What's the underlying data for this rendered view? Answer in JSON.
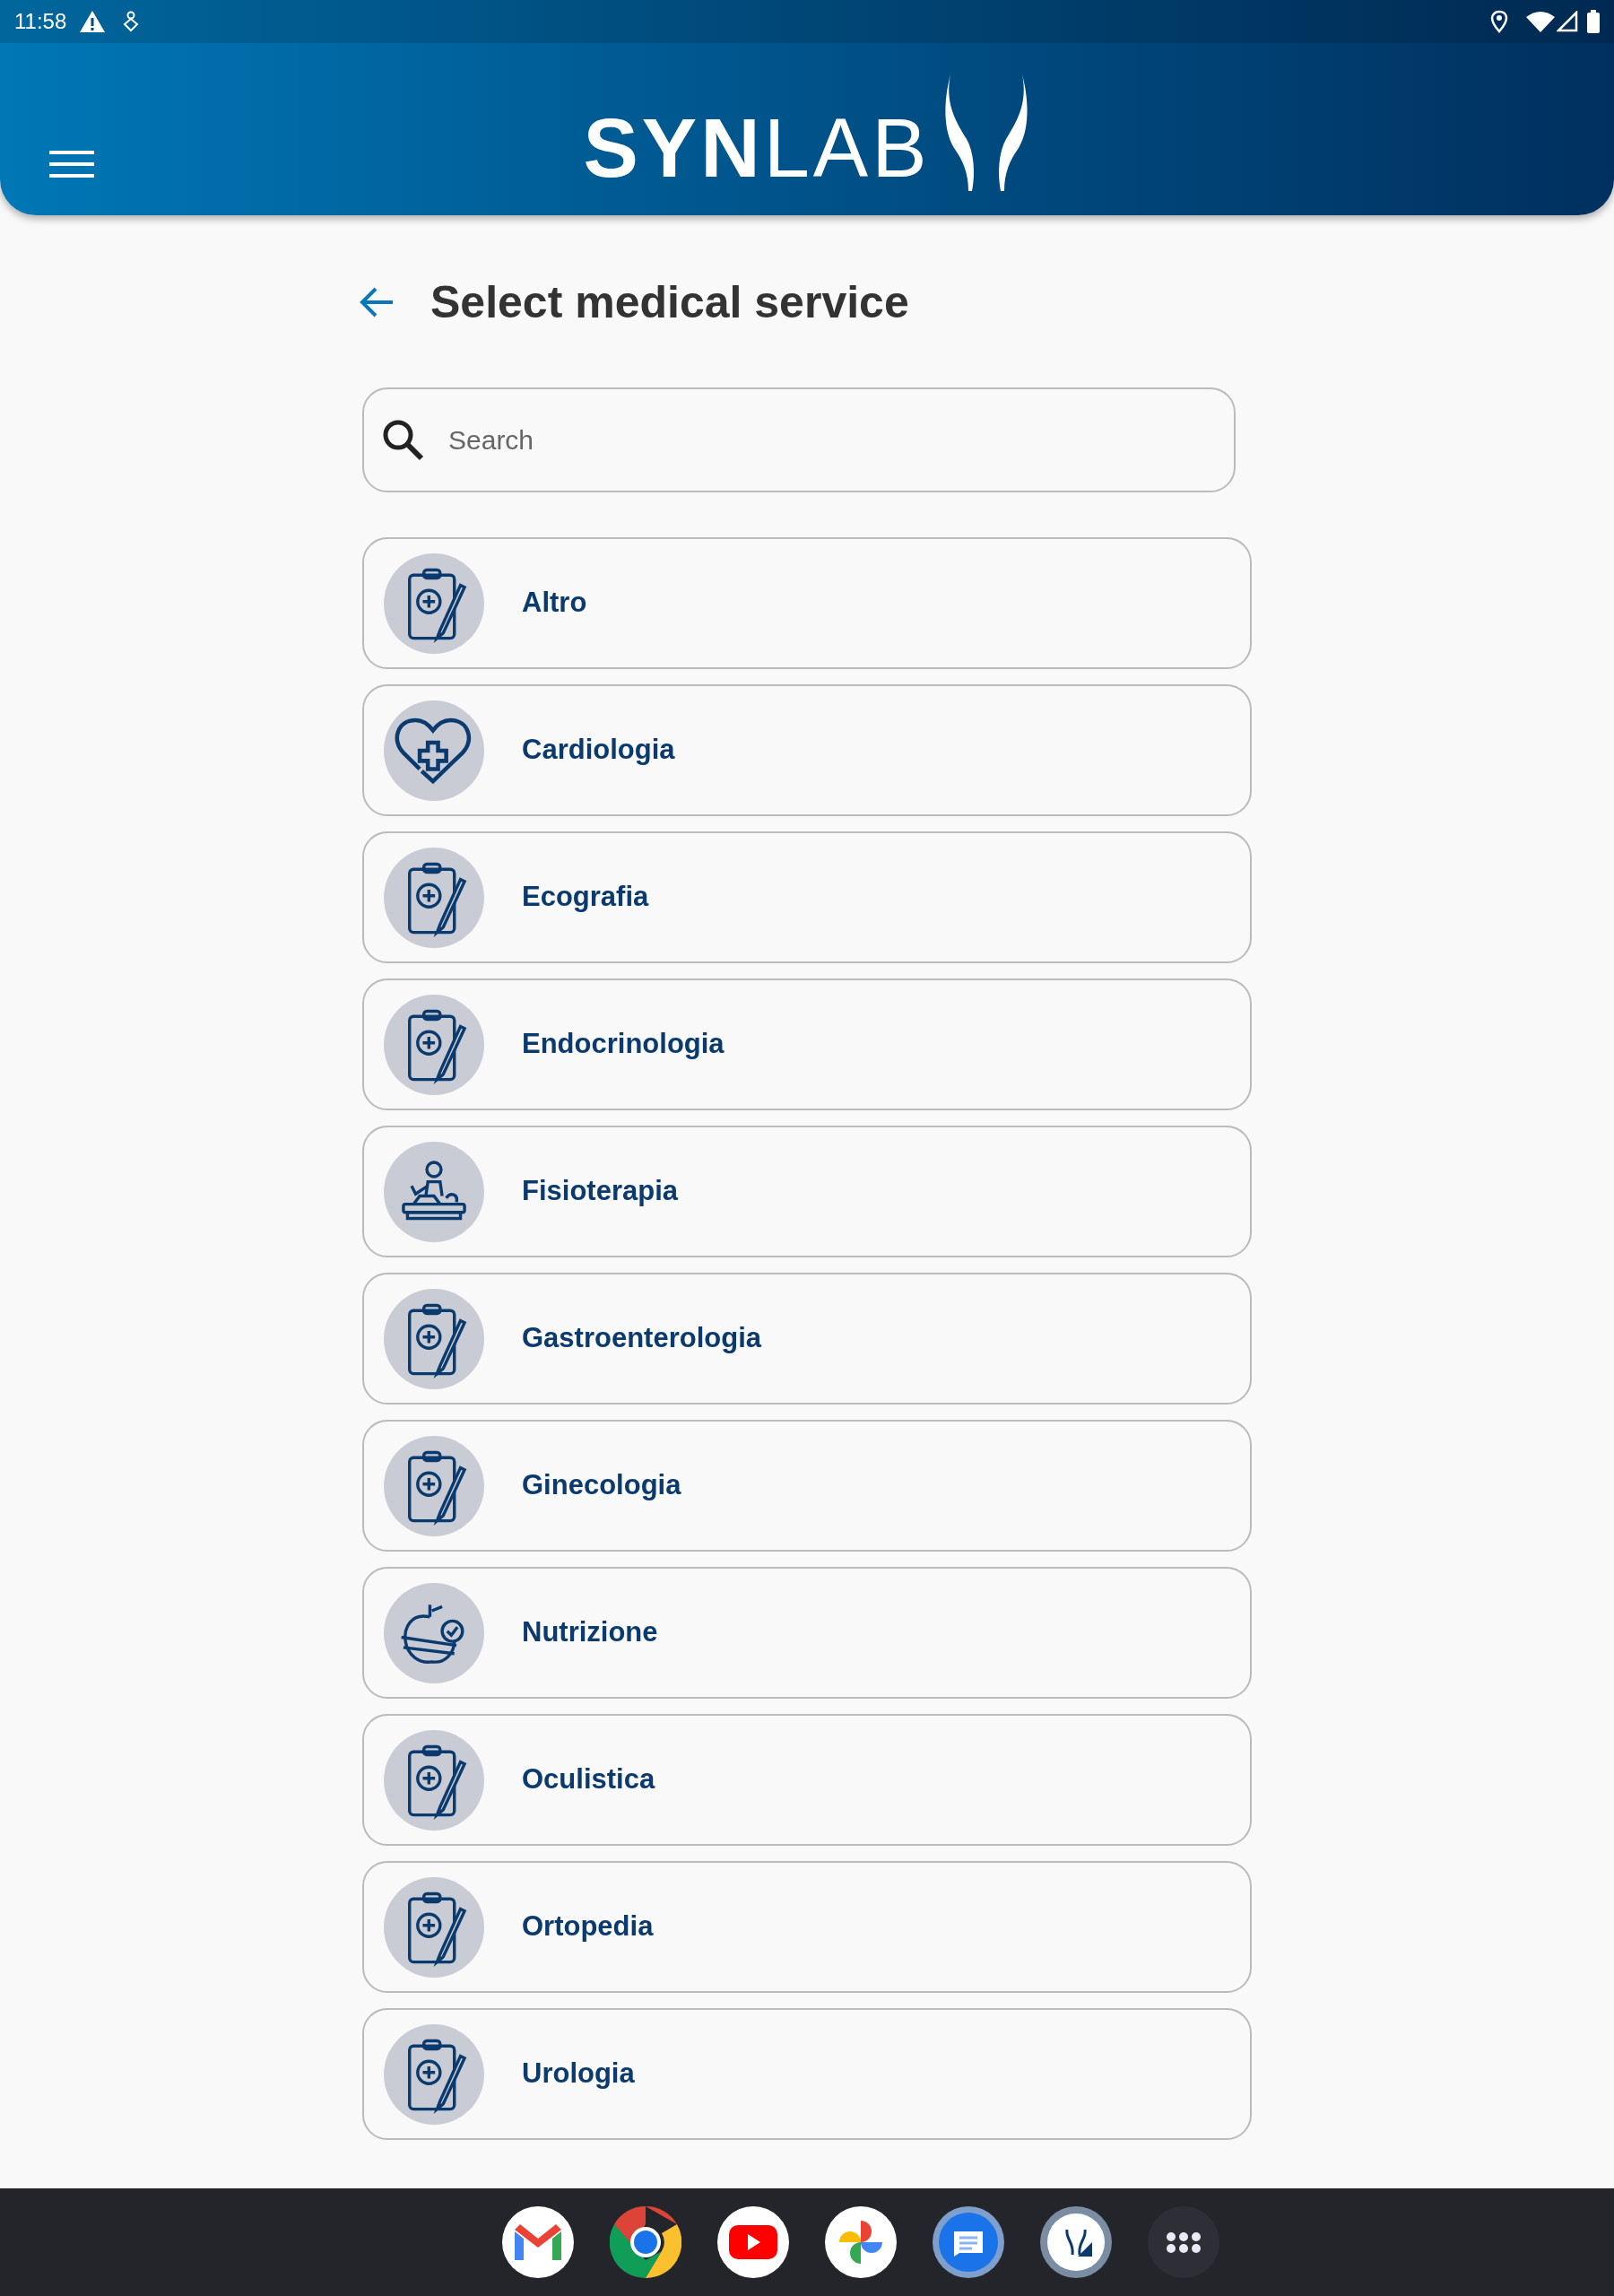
{
  "status_bar": {
    "time": "11:58"
  },
  "header": {
    "logo_bold": "SYN",
    "logo_light": "LAB"
  },
  "page": {
    "title": "Select medical service"
  },
  "search": {
    "placeholder": "Search"
  },
  "services": [
    {
      "label": "Altro",
      "kind": "clipboard"
    },
    {
      "label": "Cardiologia",
      "kind": "heart"
    },
    {
      "label": "Ecografia",
      "kind": "clipboard"
    },
    {
      "label": "Endocrinologia",
      "kind": "clipboard"
    },
    {
      "label": "Fisioterapia",
      "kind": "therapy"
    },
    {
      "label": "Gastroenterologia",
      "kind": "clipboard"
    },
    {
      "label": "Ginecologia",
      "kind": "clipboard"
    },
    {
      "label": "Nutrizione",
      "kind": "food"
    },
    {
      "label": "Oculistica",
      "kind": "clipboard"
    },
    {
      "label": "Ortopedia",
      "kind": "clipboard"
    },
    {
      "label": "Urologia",
      "kind": "clipboard"
    }
  ]
}
